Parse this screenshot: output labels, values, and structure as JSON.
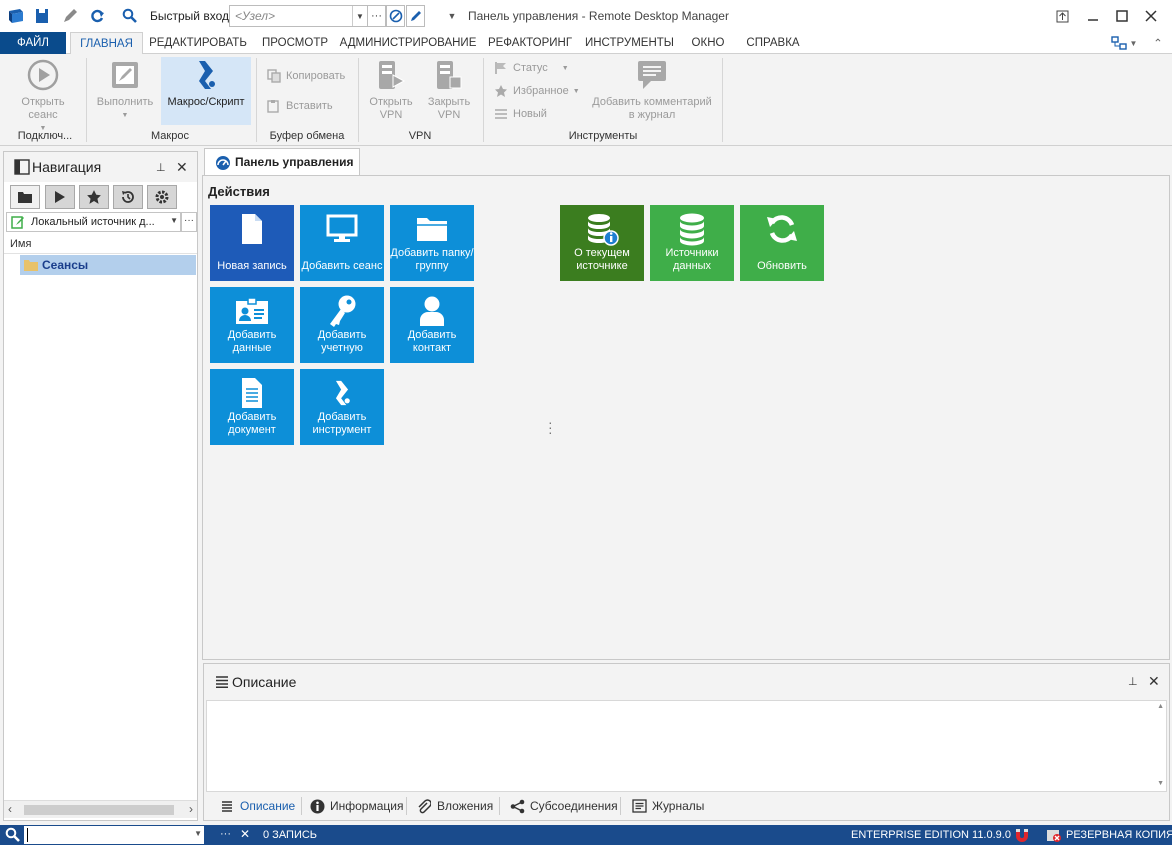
{
  "titlebar": {
    "quick_label": "Быстрый вход",
    "host_placeholder": "<Узел>",
    "window_title": "Панель управления - Remote Desktop Manager"
  },
  "menu": {
    "file": "ФАЙЛ",
    "tabs": [
      "ГЛАВНАЯ",
      "РЕДАКТИРОВАТЬ",
      "ПРОСМОТР",
      "АДМИНИСТРИРОВАНИЕ",
      "РЕФАКТОРИНГ",
      "ИНСТРУМЕНТЫ",
      "ОКНО",
      "СПРАВКА"
    ]
  },
  "ribbon": {
    "open_session": "Открыть сеанс",
    "execute": "Выполнить",
    "macro_script": "Макрос/Скрипт",
    "copy": "Копировать",
    "paste": "Вставить",
    "open_vpn": "Открыть VPN",
    "close_vpn": "Закрыть VPN",
    "status": "Статус",
    "favorite": "Избранное",
    "new": "Новый",
    "add_comment": "Добавить комментарий в журнал",
    "groups": {
      "connect": "Подключ...",
      "macro": "Макрос",
      "clipboard": "Буфер обмена",
      "vpn": "VPN",
      "tools": "Инструменты"
    }
  },
  "navigation": {
    "title": "Навигация",
    "source": "Локальный источник д...",
    "column": "Имя",
    "tree": [
      "Сеансы"
    ]
  },
  "dashboard": {
    "tab": "Панель управления",
    "section": "Действия",
    "tiles": {
      "new_entry": "Новая запись",
      "add_session": "Добавить сеанс",
      "add_folder": "Добавить папку/группу",
      "add_data": "Добавить данные",
      "add_credential": "Добавить учетную",
      "add_contact": "Добавить контакт",
      "add_document": "Добавить документ",
      "add_tool": "Добавить инструмент",
      "current_source": "О текущем источнике",
      "data_sources": "Источники данных",
      "refresh": "Обновить"
    }
  },
  "description": {
    "title": "Описание",
    "tabs": [
      "Описание",
      "Информация",
      "Вложения",
      "Субсоединения",
      "Журналы"
    ]
  },
  "statusbar": {
    "count": "0 ЗАПИСЬ",
    "edition": "ENTERPRISE EDITION 11.0.9.0",
    "backup": "РЕЗЕРВНАЯ КОПИЯ"
  },
  "colors": {
    "blue_tile": "#0d8fd8",
    "dark_blue_tile": "#1e5bb8",
    "green_tile": "#3fae49",
    "dark_green_tile": "#3b7d1f",
    "status_bar": "#1a4b8c"
  }
}
